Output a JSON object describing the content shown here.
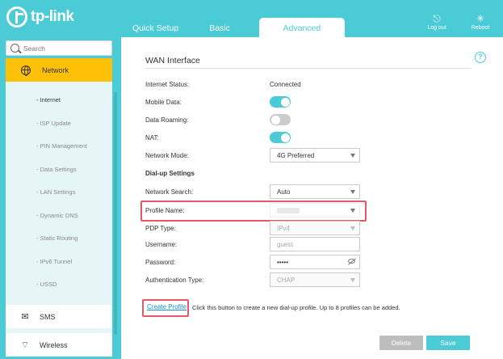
{
  "brand": {
    "name": "tp-link"
  },
  "tabs": [
    {
      "label": "Quick Setup"
    },
    {
      "label": "Basic"
    },
    {
      "label": "Advanced"
    }
  ],
  "header_actions": {
    "logout": "Log out",
    "reboot": "Reboot"
  },
  "search": {
    "placeholder": "Search"
  },
  "sidebar": {
    "active_section": "Network",
    "subitems": [
      "- Internet",
      "- ISP Update",
      "- PIN Management",
      "- Data Settings",
      "- LAN Settings",
      "- Dynamic DNS",
      "- Static Routing",
      "- IPv6 Tunnel",
      "- USSD"
    ],
    "sections": [
      "SMS",
      "Wireless"
    ]
  },
  "wan": {
    "title": "WAN Interface",
    "internet_status_label": "Internet Status:",
    "internet_status_value": "Connected",
    "mobile_data_label": "Mobile Data:",
    "mobile_data": true,
    "data_roaming_label": "Data Roaming:",
    "data_roaming": false,
    "nat_label": "NAT:",
    "nat": true,
    "network_mode_label": "Network Mode:",
    "network_mode_value": "4G Preferred",
    "dialup_heading": "Dial-up Settings",
    "network_search_label": "Network Search:",
    "network_search_value": "Auto",
    "profile_name_label": "Profile Name:",
    "pdp_type_label": "PDP Type:",
    "pdp_type_value": "IPv4",
    "username_label": "Username:",
    "username_value": "guest",
    "password_label": "Password:",
    "password_value": "•••••",
    "auth_type_label": "Authentication Type:",
    "auth_type_value": "CHAP"
  },
  "actions": {
    "create_profile": "Create Profile",
    "create_note": "Click this button to create a new dial-up profile. Up to 8 profiles can be added.",
    "delete": "Delete",
    "save": "Save"
  },
  "colors": {
    "accent": "#4acbd6",
    "active_nav": "#ffc107",
    "highlight": "#e55864",
    "link": "#1a8fd6"
  }
}
